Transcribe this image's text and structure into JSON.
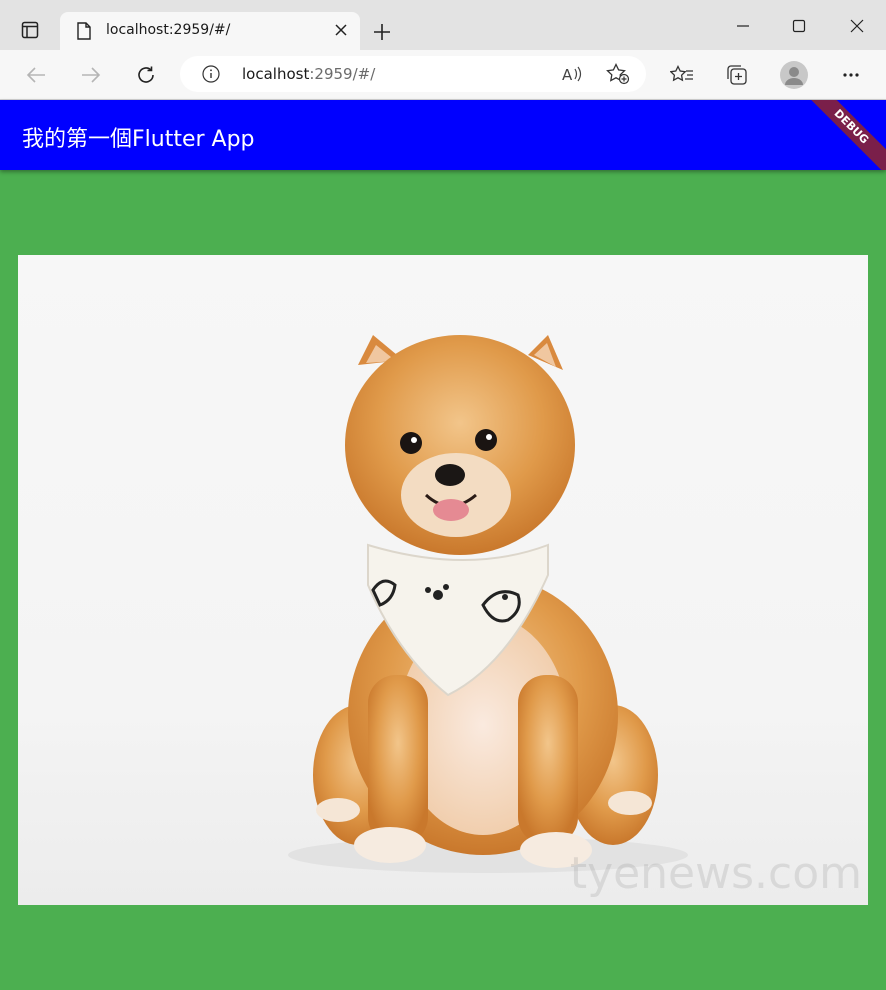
{
  "browser": {
    "tab": {
      "title": "localhost:2959/#/"
    },
    "address": {
      "host": "localhost",
      "rest": ":2959/#/"
    },
    "read_aloud_label": "A⁾"
  },
  "app": {
    "title": "我的第一個Flutter App",
    "debug_banner": "DEBUG",
    "appbar_color": "#0000ff",
    "background_color": "#4caf50"
  },
  "image": {
    "subject": "pomeranian-dog-with-bandana",
    "watermark": "tyenews.com"
  }
}
